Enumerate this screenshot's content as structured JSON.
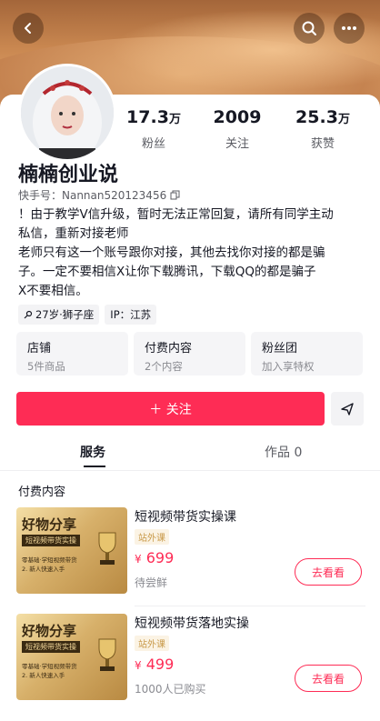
{
  "header": {
    "back_icon": "chevron-left-icon",
    "search_icon": "search-icon",
    "more_icon": "more-dots-icon"
  },
  "stats": [
    {
      "value": "17.3",
      "unit": "万",
      "label": "粉丝"
    },
    {
      "value": "2009",
      "unit": "",
      "label": "关注"
    },
    {
      "value": "25.3",
      "unit": "万",
      "label": "获赞"
    }
  ],
  "profile": {
    "name": "楠楠创业说",
    "uid_label": "快手号：Nannan520123456",
    "bio_lines": [
      "！由于教学V信升级，暂时无法正常回复，请所有同学主动",
      "私信，重新对接老师",
      "老师只有这一个账号跟你对接，其他去找你对接的都是骗",
      "子。一定不要相信X让你下载腾讯，下载QQ的都是骗子",
      "X不要相信。"
    ],
    "tags": [
      "27岁·狮子座",
      "IP：江苏"
    ]
  },
  "cards": [
    {
      "title": "店铺",
      "sub": "5件商品"
    },
    {
      "title": "付费内容",
      "sub": "2个内容"
    },
    {
      "title": "粉丝团",
      "sub": "加入享特权"
    }
  ],
  "actions": {
    "follow_label": "＋ 关注",
    "share_icon": "send-icon",
    "accent": "#fe2c55"
  },
  "tabs": {
    "service": "服务",
    "works": "作品 0"
  },
  "section_title": "付费内容",
  "products": [
    {
      "title": "短视频带货实操课",
      "badge": "站外课",
      "price_symbol": "¥",
      "price": "699",
      "sub": "待尝鲜",
      "button": "去看看",
      "thumb": {
        "big": "好物分享",
        "bar": "短视频带货实操",
        "line1": "零基础·学短视频带货",
        "line2": "2. 新人快速入手"
      }
    },
    {
      "title": "短视频带货落地实操",
      "badge": "站外课",
      "price_symbol": "¥",
      "price": "499",
      "sub": "1000人已购买",
      "button": "去看看",
      "thumb": {
        "big": "好物分享",
        "bar": "短视频带货实操",
        "line1": "零基础·学短视频带货",
        "line2": "2. 新人快速入手"
      }
    }
  ]
}
